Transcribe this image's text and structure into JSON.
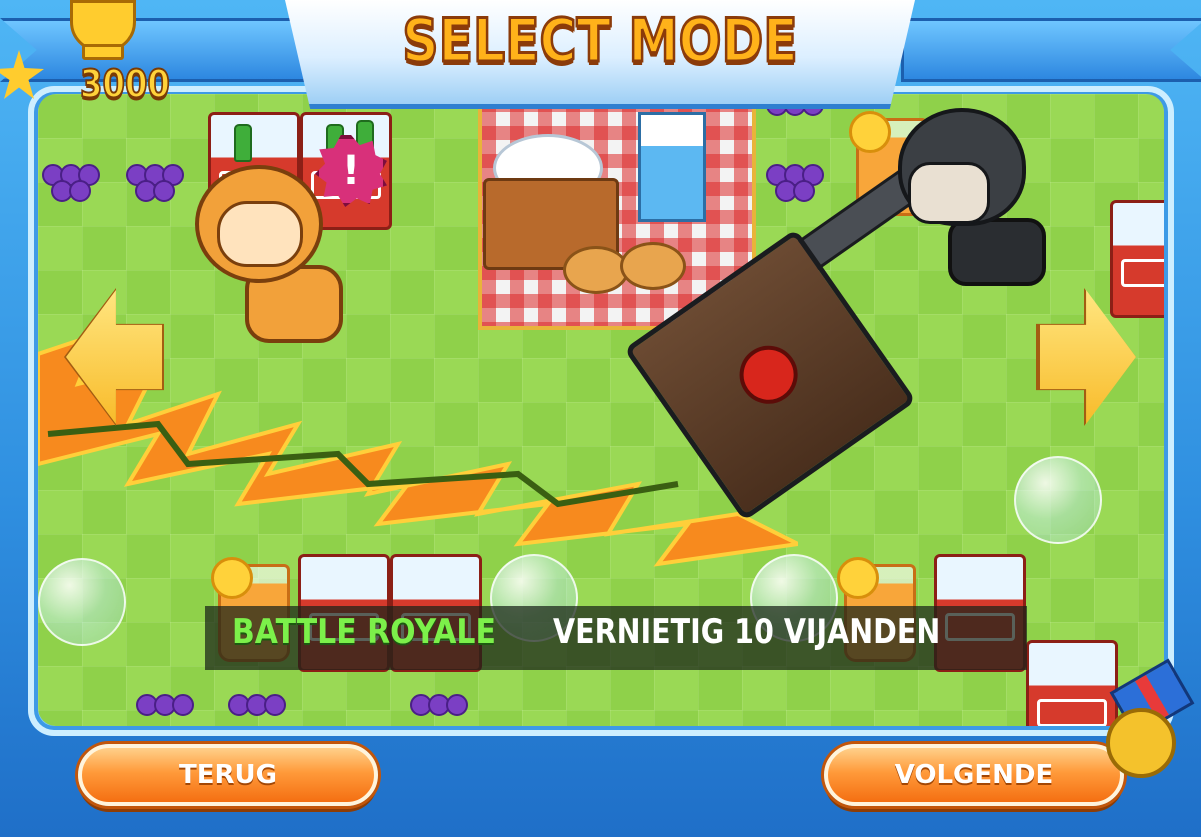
{
  "header": {
    "title": "SELECT MODE"
  },
  "score": {
    "value": "3000",
    "icon": "trophy-icon"
  },
  "mode": {
    "name": "BATTLE ROYALE",
    "description": "VERNIETIG 10 VIJANDEN"
  },
  "nav": {
    "prev_icon": "arrow-left-icon",
    "next_icon": "arrow-right-icon"
  },
  "buttons": {
    "back_label": "TERUG",
    "next_label": "VOLGENDE"
  },
  "alert": {
    "symbol": "!"
  },
  "colors": {
    "frame": "#2f8fe0",
    "grass": "#8fd14a",
    "title": "#ffb21a",
    "mode_name": "#7cf04a",
    "button": "#ff9a3a",
    "arrow": "#f8bb2a"
  }
}
